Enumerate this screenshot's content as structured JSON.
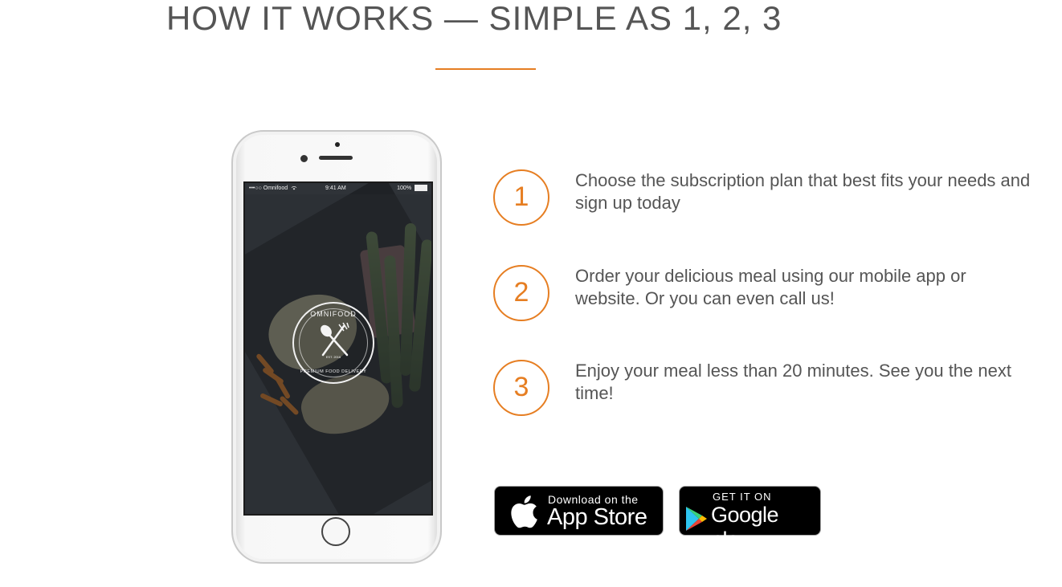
{
  "section": {
    "title": "HOW IT WORKS — SIMPLE AS 1, 2, 3"
  },
  "phone": {
    "status_carrier": "•••○○ Omnifood",
    "status_time": "9:41 AM",
    "status_battery": "100%",
    "logo_top": "OMNIFOOD",
    "logo_est": "EST. 2016",
    "logo_bottom": "PREMIUM FOOD DELIVERY"
  },
  "steps": [
    {
      "number": "1",
      "text": "Choose the subscription plan that best fits your needs and sign up today"
    },
    {
      "number": "2",
      "text": "Order your delicious meal using our mobile app or website. Or you can even call us!"
    },
    {
      "number": "3",
      "text": "Enjoy your meal less than 20 minutes. See you the next time!"
    }
  ],
  "badges": {
    "app_store_small": "Download on the",
    "app_store_big": "App Store",
    "google_small": "GET IT ON",
    "google_big": "Google play"
  },
  "colors": {
    "accent": "#e67e22",
    "text": "#555555",
    "badge_bg": "#000000"
  },
  "icons": [
    "apple-icon",
    "google-play-icon",
    "wifi-icon",
    "battery-icon",
    "spoon-icon",
    "fork-icon"
  ]
}
